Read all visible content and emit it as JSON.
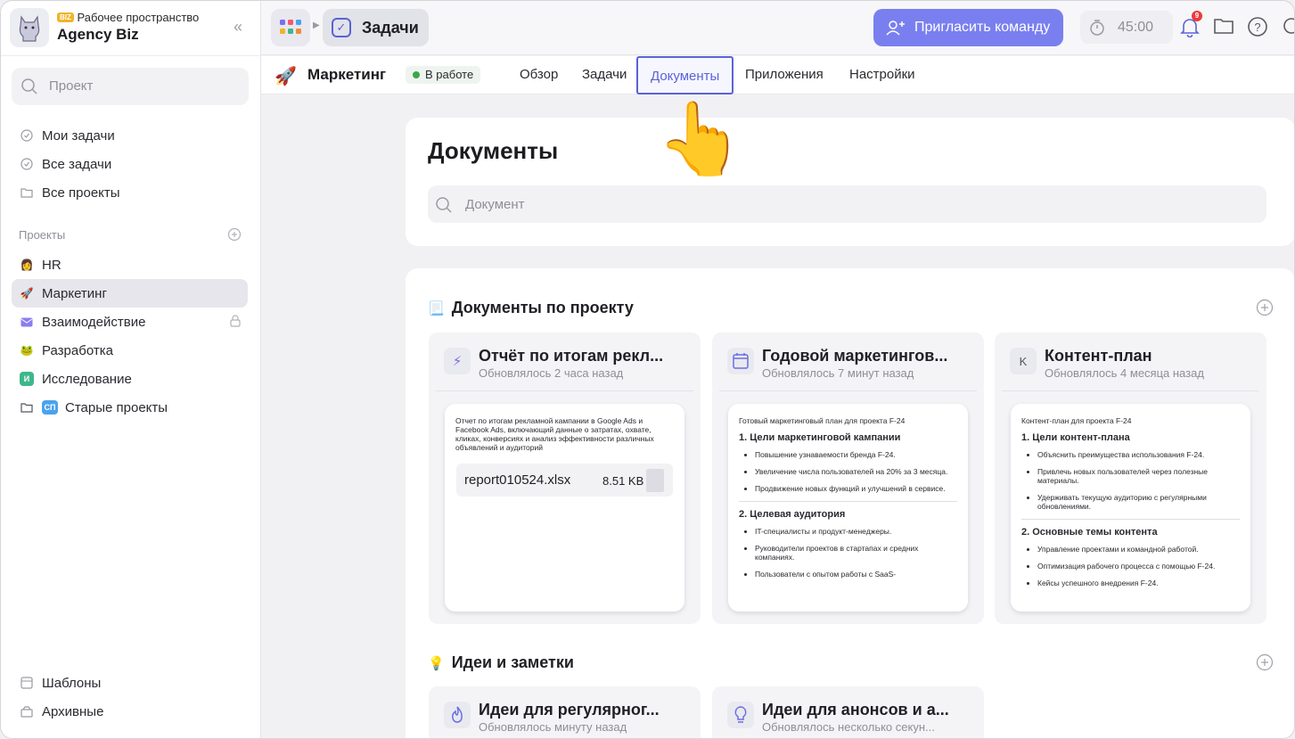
{
  "workspace": {
    "badge": "BIZ",
    "subtitle": "Рабочее пространство",
    "name": "Agency Biz"
  },
  "sidebar": {
    "search_placeholder": "Проект",
    "nav": [
      {
        "label": "Мои задачи",
        "icon": "check-circle-icon"
      },
      {
        "label": "Все задачи",
        "icon": "check-circle-icon"
      },
      {
        "label": "Все проекты",
        "icon": "folder-icon"
      }
    ],
    "projects_label": "Проекты",
    "projects": [
      {
        "label": "HR",
        "icon": "person-emoji-icon"
      },
      {
        "label": "Маркетинг",
        "icon": "rocket-icon",
        "active": true
      },
      {
        "label": "Взаимодействие",
        "icon": "envelope-icon",
        "locked": true
      },
      {
        "label": "Разработка",
        "icon": "frog-icon"
      },
      {
        "label": "Исследование",
        "icon": "letter-badge-icon",
        "badge": "И"
      },
      {
        "label": "Старые проекты",
        "icon": "folder-icon",
        "badge": "СП"
      }
    ],
    "footer": [
      {
        "label": "Шаблоны",
        "icon": "templates-icon"
      },
      {
        "label": "Архивные",
        "icon": "archive-icon"
      }
    ]
  },
  "topbar": {
    "tasks_label": "Задачи",
    "invite_label": "Пригласить команду",
    "timer": "45:00",
    "notifications_count": "9"
  },
  "project": {
    "name": "Маркетинг",
    "status": "В работе",
    "tabs": [
      {
        "label": "Обзор"
      },
      {
        "label": "Задачи"
      },
      {
        "label": "Документы",
        "active": true
      },
      {
        "label": "Приложения"
      },
      {
        "label": "Настройки"
      }
    ]
  },
  "documents": {
    "title": "Документы",
    "search_placeholder": "Документ",
    "sections": [
      {
        "title": "Документы по проекту",
        "emoji": "📃",
        "cards": [
          {
            "title": "Отчёт по итогам рекл...",
            "updated": "Обновлялось 2 часа назад",
            "icon": "bolt-icon",
            "intro": "Отчет по итогам рекламной кампании в Google Ads и Facebook Ads, включающий данные о затратах, охвате, кликах, конверсиях и анализ эффективности различных объявлений и аудиторий",
            "file_name": "report010524.xlsx",
            "file_size": "8.51 KB"
          },
          {
            "title": "Годовой маркетингов...",
            "updated": "Обновлялось 7 минут назад",
            "icon": "calendar-icon",
            "intro": "Готовый маркетинговый план для проекта F-24",
            "h1": "1. Цели маркетинговой кампании",
            "list1": [
              "Повышение узнаваемости бренда F-24.",
              "Увеличение числа пользователей на 20% за 3 месяца.",
              "Продвижение новых функций и улучшений в сервисе."
            ],
            "h2": "2. Целевая аудитория",
            "list2": [
              "IT-специалисты и продукт-менеджеры.",
              "Руководители проектов в стартапах и средних компаниях.",
              "Пользователи с опытом работы с SaaS-"
            ]
          },
          {
            "title": "Контент-план",
            "updated": "Обновлялось 4 месяца назад",
            "icon": "letter-k-icon",
            "icon_letter": "K",
            "intro": "Контент-план для проекта F-24",
            "h1": "1. Цели контент-плана",
            "list1": [
              "Объяснить преимущества использования F-24.",
              "Привлечь новых пользователей через полезные материалы.",
              "Удерживать текущую аудиторию с регулярными обновлениями."
            ],
            "h2": "2. Основные темы контента",
            "list2": [
              "Управление проектами и командной работой.",
              "Оптимизация рабочего процесса с помощью F-24.",
              "Кейсы успешного внедрения F-24."
            ]
          }
        ]
      },
      {
        "title": "Идеи и заметки",
        "emoji": "💡",
        "cards": [
          {
            "title": "Идеи для регулярног...",
            "updated": "Обновлялось минуту назад",
            "icon": "flame-icon"
          },
          {
            "title": "Идеи для анонсов и а...",
            "updated": "Обновлялось несколько секун...",
            "icon": "lightbulb-icon"
          }
        ]
      }
    ]
  },
  "colors": {
    "accent": "#5b63d8",
    "invite_bg": "#7a7ff0",
    "status_green": "#3ca64a",
    "notif_red": "#ec3a3a"
  }
}
